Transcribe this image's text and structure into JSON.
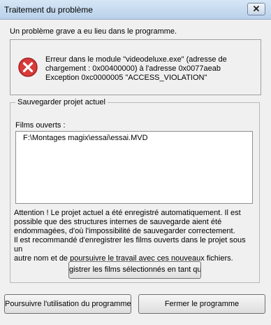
{
  "window": {
    "title": "Traitement du problème",
    "close_symbol": "✕"
  },
  "intro_text": "Un problème grave a eu lieu dans le programme.",
  "error": {
    "icon": "error-icon",
    "line1": "Erreur dans le module \"videodeluxe.exe\" (adresse de",
    "line2": "chargement : 0x00400000) à l'adresse 0x0077aeab",
    "line3": "Exception 0xc0000005 \"ACCESS_VIOLATION\""
  },
  "save_group": {
    "legend": "Sauvegarder projet actuel",
    "films_label": "Films ouverts :",
    "films": [
      "F:\\Montages magix\\essai\\essai.MVD"
    ],
    "warning_lines": [
      "Attention ! Le projet actuel a été enregistré automatiquement. Il est",
      "possible que des structures internes de sauvegarde aient été",
      "endommagées, d'où l'impossibilité de sauvegarder correctement.",
      "Il est recommandé d'enregistrer les films ouverts dans le projet sous un",
      "autre nom et de poursuivre le travail avec ces nouveaux fichiers."
    ],
    "save_button": "gistrer les films sélectionnés en tant qu"
  },
  "buttons": {
    "continue": "Poursuivre l'utilisation du programme",
    "close": "Fermer le programme"
  },
  "colors": {
    "error_red": "#d83a3a",
    "window_bg": "#f0f0f0"
  }
}
